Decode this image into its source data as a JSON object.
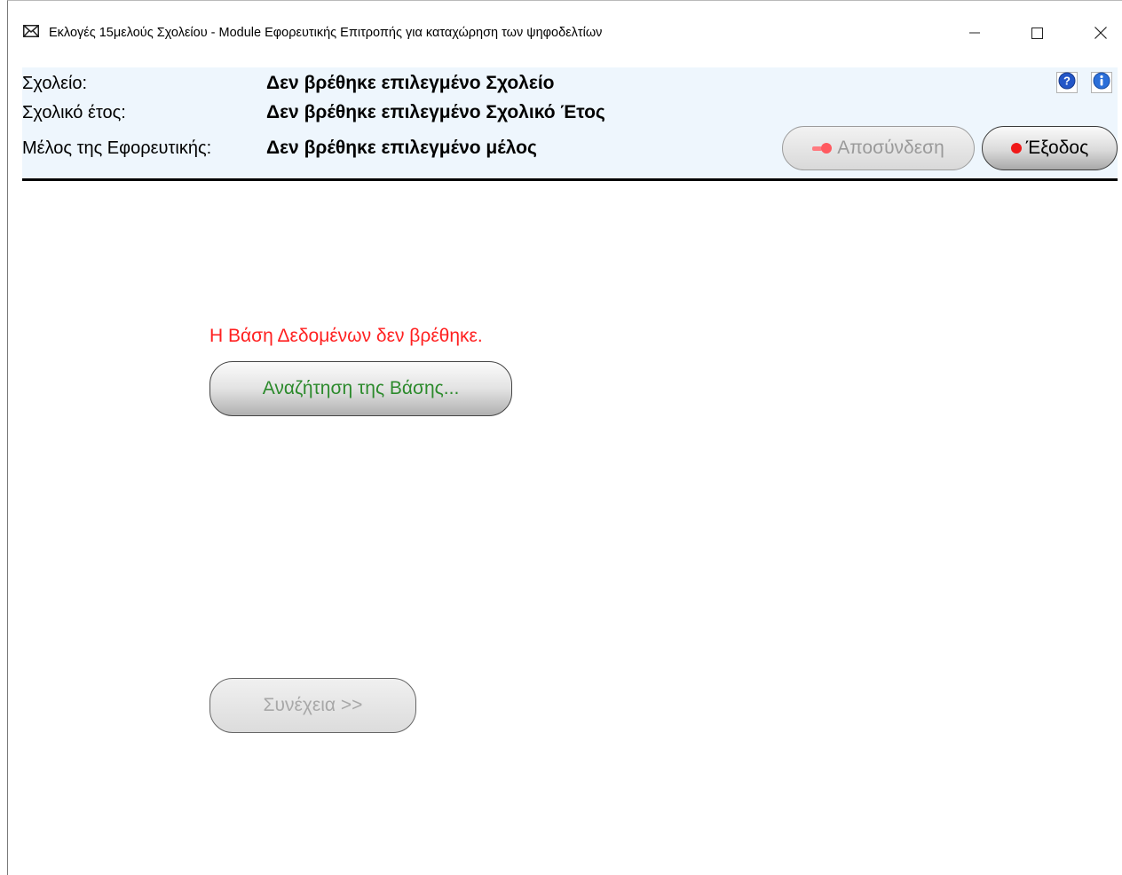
{
  "window": {
    "title": "Εκλογές 15μελούς Σχολείου - Module Εφορευτικής Επιτροπής για καταχώρηση των ψηφοδελτίων",
    "icon": "envelope-icon",
    "controls": [
      "minimize-icon",
      "maximize-icon",
      "close-icon"
    ]
  },
  "header": {
    "school_label": "Σχολείο:",
    "school_value": "Δεν βρέθηκε επιλεγμένο Σχολείο",
    "year_label": "Σχολικό έτος:",
    "year_value": "Δεν βρέθηκε επιλεγμένο Σχολικό Έτος",
    "member_label": "Μέλος της Εφορευτικής:",
    "member_value": "Δεν βρέθηκε επιλεγμένο μέλος",
    "help_icon": "help-icon",
    "info_icon": "info-icon",
    "disconnect_label": "Αποσύνδεση",
    "exit_label": "Έξοδος"
  },
  "main": {
    "error_message": "Η Βάση Δεδομένων δεν βρέθηκε.",
    "search_db_label": "Αναζήτηση της Βάσης...",
    "continue_label": "Συνέχεια >>"
  },
  "colors": {
    "header_bg": "#eef6fd",
    "error": "#ff2020",
    "search_text": "#2c8a2c",
    "disabled_text": "#a8a8a8",
    "exit_dot": "#f01818"
  }
}
